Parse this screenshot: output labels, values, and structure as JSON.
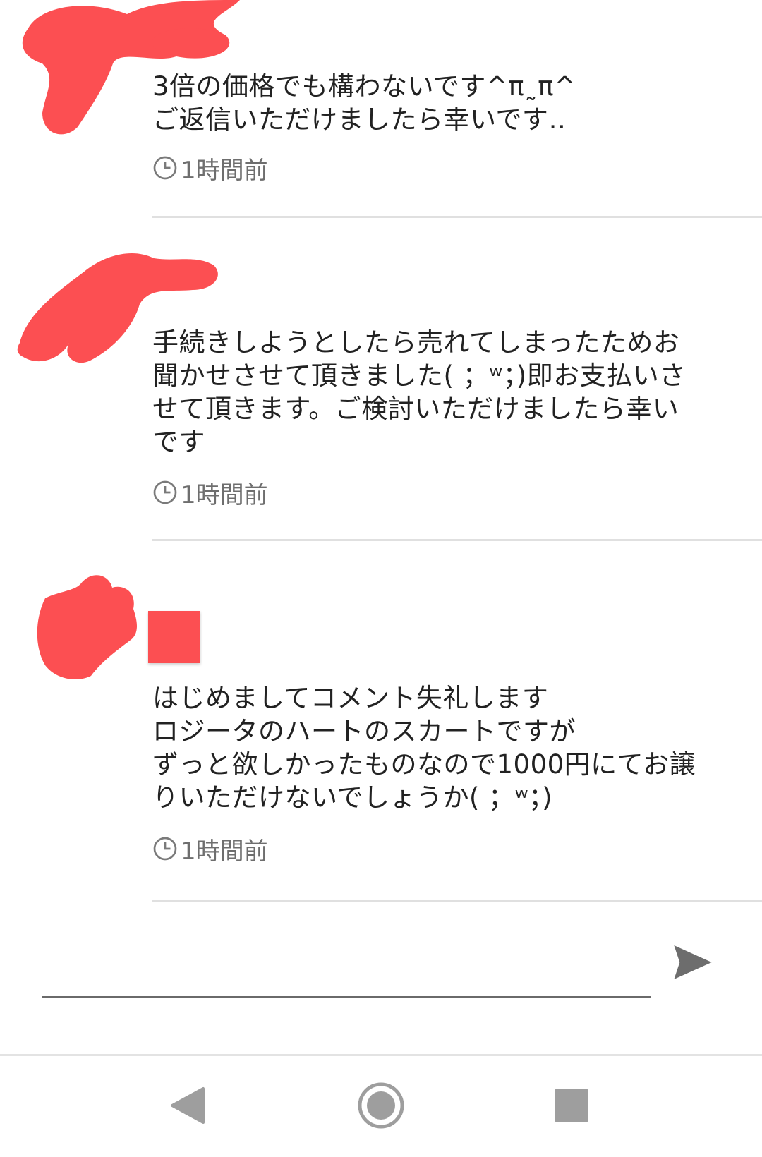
{
  "comments": [
    {
      "text": "3倍の価格でも構わないです^π˷π^\nご返信いただけましたら幸いです‥",
      "time": "1時間前"
    },
    {
      "text": "手続きしようとしたら売れてしまったためお\n聞かせさせて頂きました( ；ʷ；)即お支払いさ\nせて頂きます。ご検討いただけましたら幸い\nです",
      "time": "1時間前"
    },
    {
      "text": "はじめましてコメント失礼します\nロジータのハートのスカートですが\nずっと欲しかったものなので1000円にてお譲\nりいただけないでしょうか( ；ʷ；)",
      "time": "1時間前"
    }
  ],
  "reply": {
    "value": "",
    "placeholder": ""
  },
  "icons": {
    "clock": "clock-icon",
    "send": "send-icon",
    "back": "back-icon",
    "home": "home-icon",
    "recents": "recents-icon"
  },
  "colors": {
    "redaction": "#fc4f52",
    "text": "#222222",
    "muted": "#6e6e6e",
    "divider": "#e0e0e0",
    "nav_icon": "#9e9e9e"
  }
}
